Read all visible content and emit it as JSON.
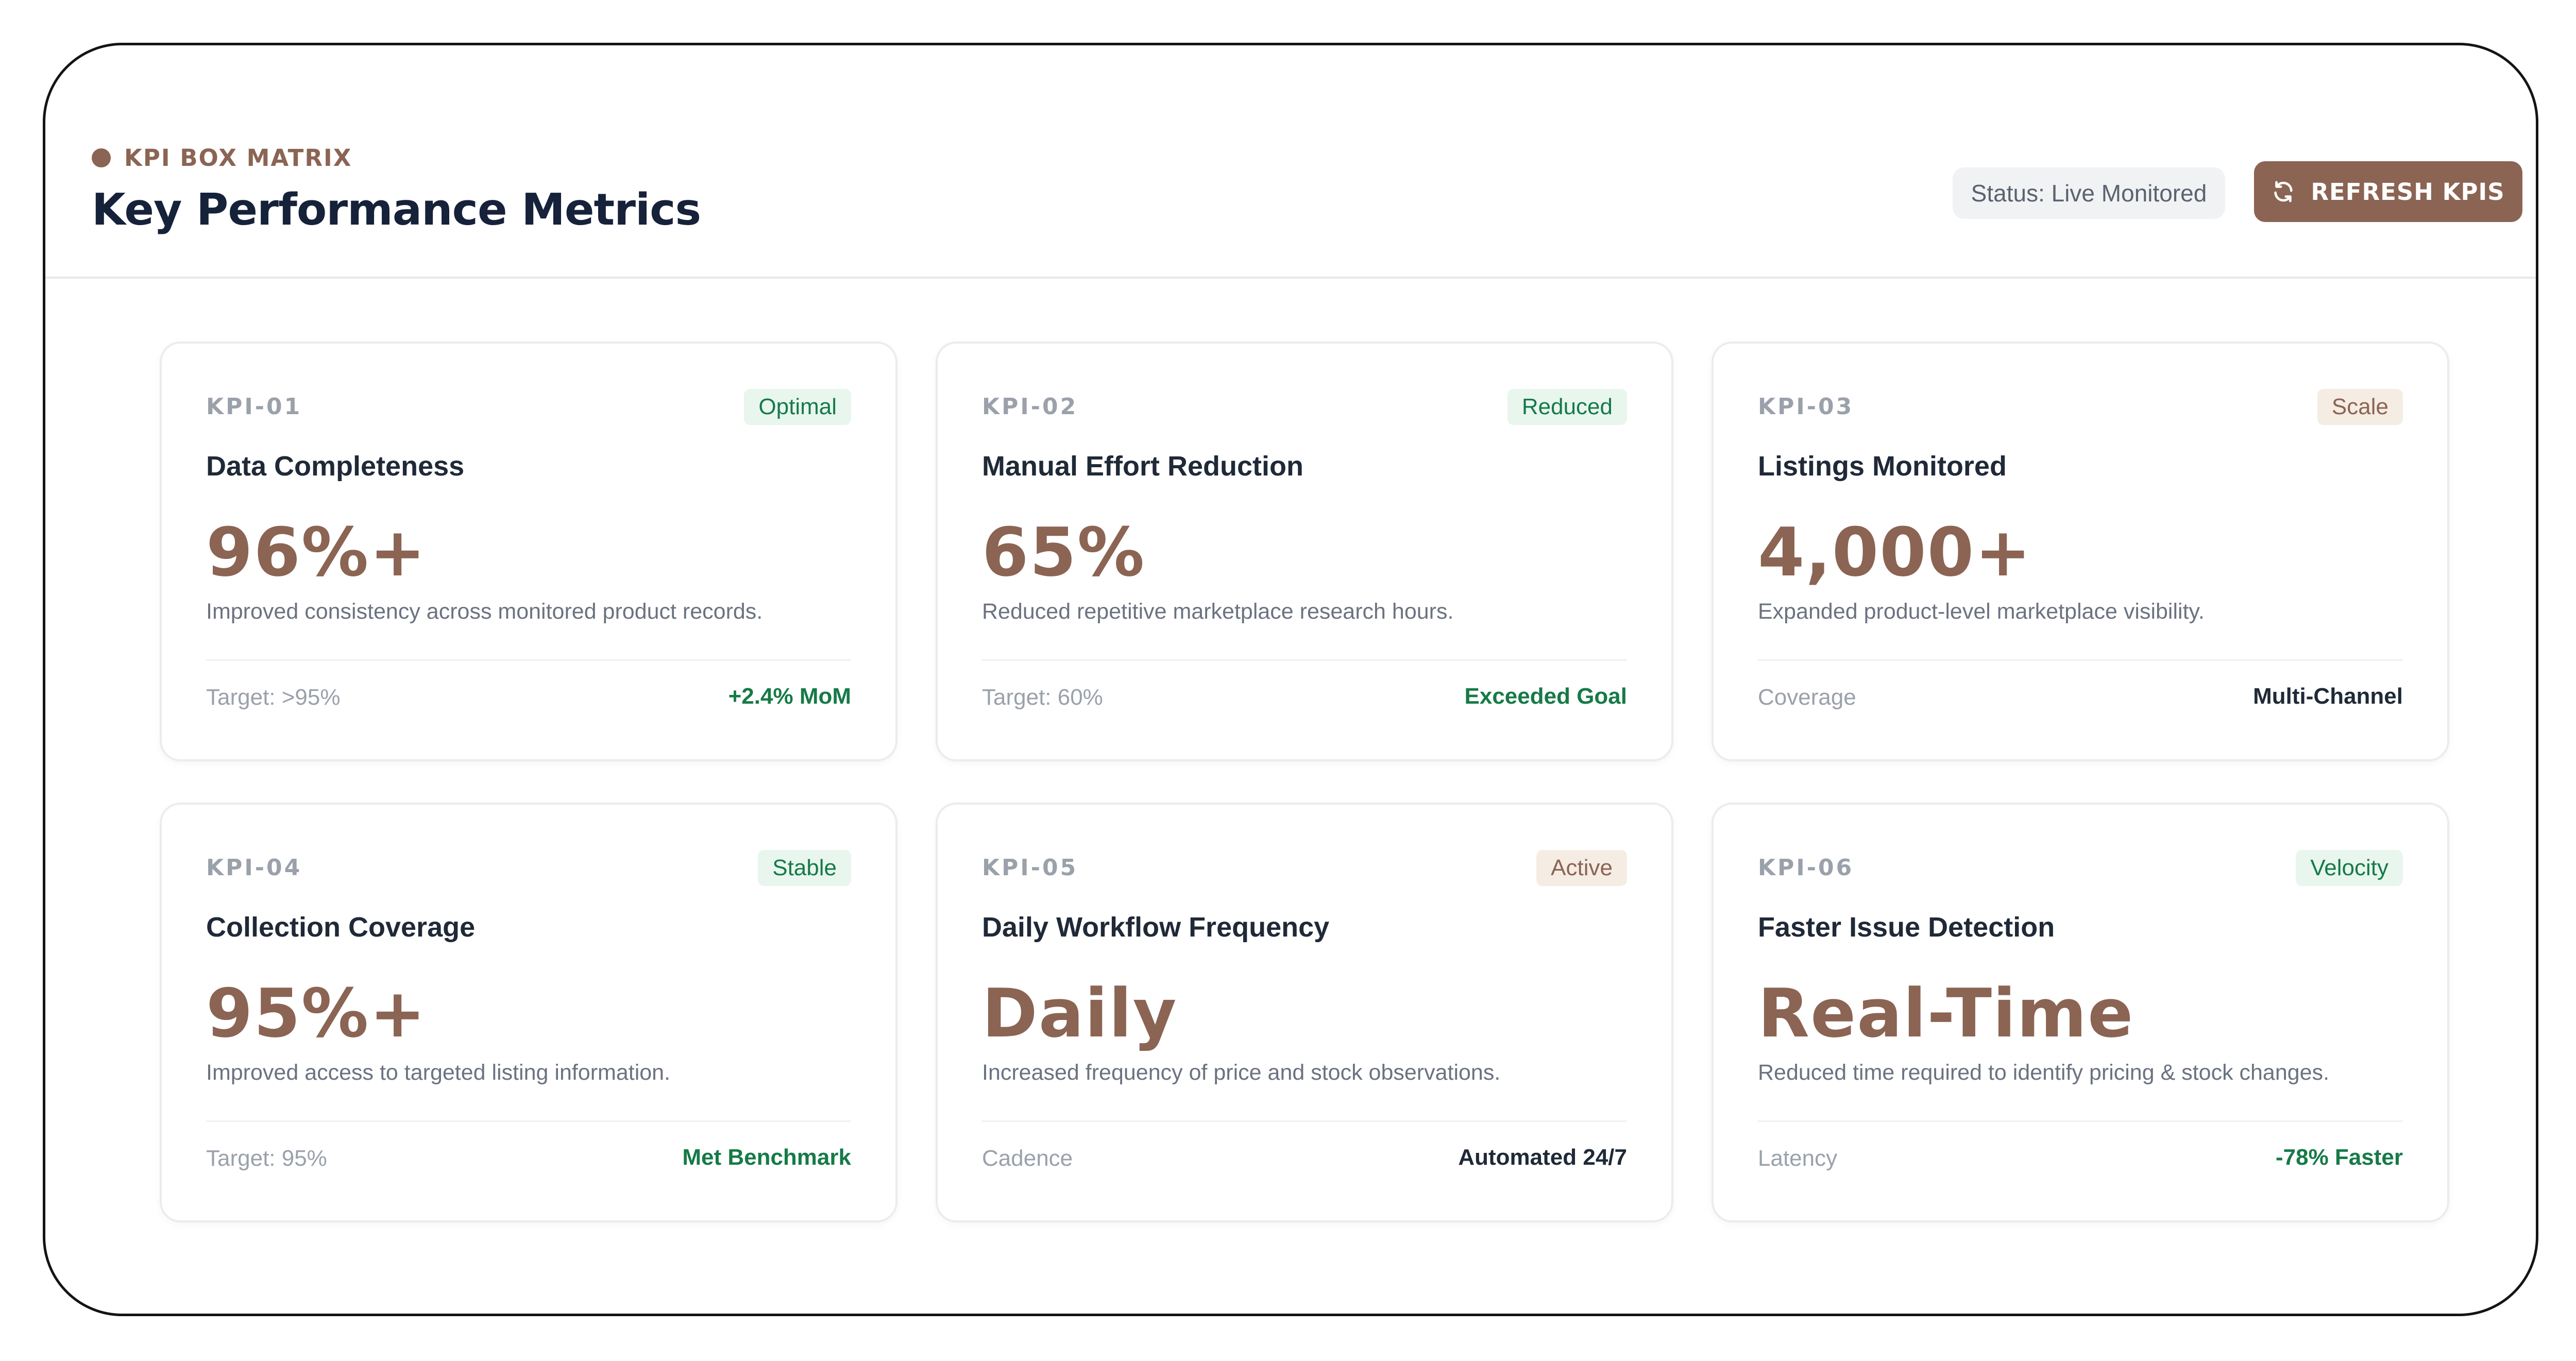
{
  "header": {
    "eyebrow": "KPI BOX MATRIX",
    "title": "Key Performance Metrics",
    "status": "Status: Live Monitored",
    "refresh_label": "REFRESH KPIS"
  },
  "cards": [
    {
      "id": "KPI-01",
      "badge": "Optimal",
      "title": "Data Completeness",
      "value": "96%+",
      "description": "Improved consistency across monitored product records.",
      "meta": "Target: >95%",
      "trend": "+2.4% MoM"
    },
    {
      "id": "KPI-02",
      "badge": "Reduced",
      "title": "Manual Effort Reduction",
      "value": "65%",
      "description": "Reduced repetitive marketplace research hours.",
      "meta": "Target: 60%",
      "trend": "Exceeded Goal"
    },
    {
      "id": "KPI-03",
      "badge": "Scale",
      "title": "Listings Monitored",
      "value": "4,000+",
      "description": "Expanded product-level marketplace visibility.",
      "meta": "Coverage",
      "trend": "Multi-Channel"
    },
    {
      "id": "KPI-04",
      "badge": "Stable",
      "title": "Collection Coverage",
      "value": "95%+",
      "description": "Improved access to targeted listing information.",
      "meta": "Target: 95%",
      "trend": "Met Benchmark"
    },
    {
      "id": "KPI-05",
      "badge": "Active",
      "title": "Daily Workflow Frequency",
      "value": "Daily",
      "description": "Increased frequency of price and stock observations.",
      "meta": "Cadence",
      "trend": "Automated 24/7"
    },
    {
      "id": "KPI-06",
      "badge": "Velocity",
      "title": "Faster Issue Detection",
      "value": "Real-Time",
      "description": "Reduced time required to identify pricing & stock changes.",
      "meta": "Latency",
      "trend": "-78% Faster"
    }
  ],
  "colors": {
    "accent": "#8b6453",
    "positive": "#167a47",
    "heading": "#16213a"
  }
}
